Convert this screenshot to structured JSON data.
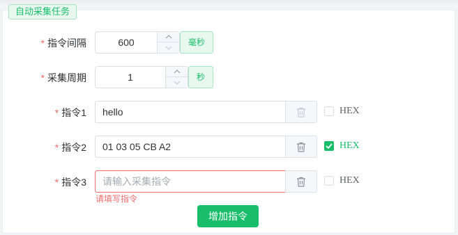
{
  "section": {
    "title": "自动采集任务"
  },
  "form": {
    "interval": {
      "label": "指令间隔",
      "value": "600",
      "unit": "毫秒"
    },
    "period": {
      "label": "采集周期",
      "value": "1",
      "unit": "秒"
    },
    "commands": [
      {
        "label": "指令1",
        "value": "hello",
        "placeholder": "",
        "hex_label": "HEX",
        "hex_checked": false
      },
      {
        "label": "指令2",
        "value": "01 03 05 CB A2",
        "placeholder": "",
        "hex_label": "HEX",
        "hex_checked": true
      },
      {
        "label": "指令3",
        "value": "",
        "placeholder": "请输入采集指令",
        "hex_label": "HEX",
        "hex_checked": false,
        "error": "请填写指令"
      }
    ],
    "add_button": "增加指令",
    "required_mark": "*"
  },
  "colors": {
    "accent": "#19be6b",
    "error": "#f56c6c",
    "border": "#dcdfe6"
  }
}
